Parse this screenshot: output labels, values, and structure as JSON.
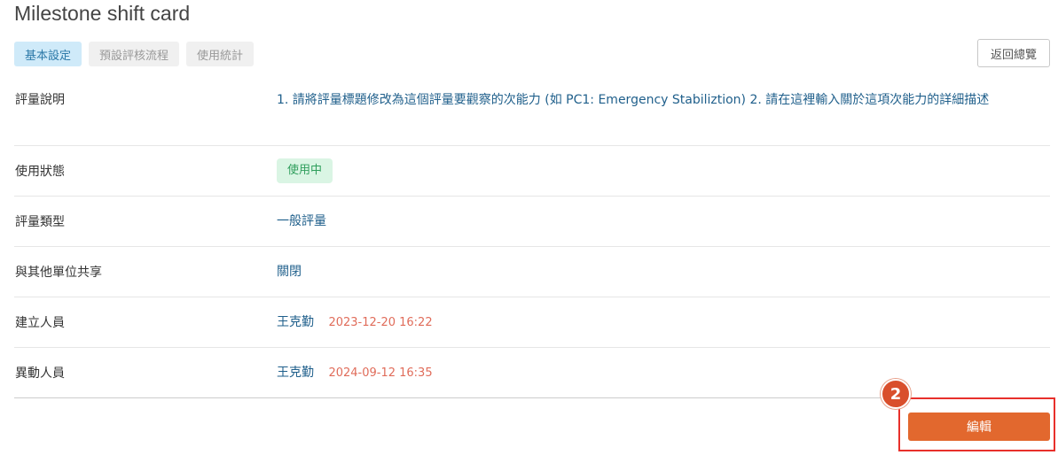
{
  "page": {
    "title": "Milestone shift card"
  },
  "tabs": [
    {
      "label": "基本設定",
      "active": true
    },
    {
      "label": "預設評核流程",
      "active": false
    },
    {
      "label": "使用統計",
      "active": false
    }
  ],
  "back_button": {
    "label": "返回總覽"
  },
  "details": {
    "description": {
      "label": "評量說明",
      "value": "1. 請將評量標題修改為這個評量要觀察的次能力 (如 PC1: Emergency Stabiliztion) 2. 請在這裡輸入關於這項次能力的詳細描述"
    },
    "status": {
      "label": "使用狀態",
      "value": "使用中"
    },
    "type": {
      "label": "評量類型",
      "value": "一般評量"
    },
    "sharing": {
      "label": "與其他單位共享",
      "value": "關閉"
    },
    "creator": {
      "label": "建立人員",
      "name": "王克勤",
      "time": "2023-12-20 16:22"
    },
    "modifier": {
      "label": "異動人員",
      "name": "王克勤",
      "time": "2024-09-12 16:35"
    }
  },
  "annotation": {
    "step": "2"
  },
  "edit_button": {
    "label": "編輯"
  },
  "colors": {
    "primary_action": "#e2682e",
    "active_tab_bg": "#cfeaf9",
    "status_badge_bg": "#daf5e4",
    "timestamp": "#e06c5a",
    "highlight": "#e8302b"
  }
}
